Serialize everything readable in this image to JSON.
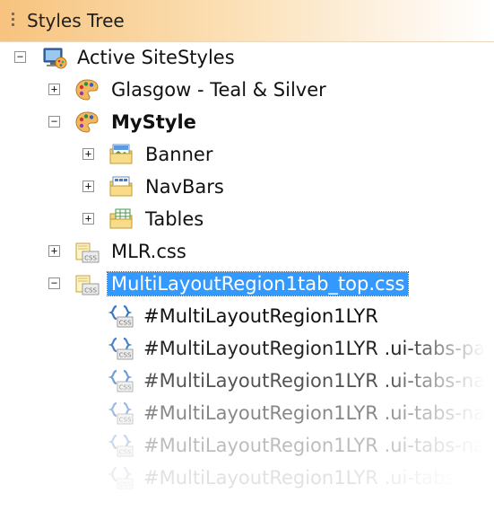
{
  "panel": {
    "title": "Styles Tree"
  },
  "tree": {
    "root": {
      "label": "Active SiteStyles",
      "expander": "−"
    },
    "styles": [
      {
        "label": "Glasgow - Teal & Silver",
        "expander": "+"
      },
      {
        "label": "MyStyle",
        "expander": "−"
      }
    ],
    "mystyle_children": [
      {
        "label": "Banner",
        "expander": "+"
      },
      {
        "label": "NavBars",
        "expander": "+"
      },
      {
        "label": "Tables",
        "expander": "+"
      }
    ],
    "css_files": [
      {
        "label": "MLR.css",
        "expander": "+"
      },
      {
        "label": "MultiLayoutRegion1tab_top.css",
        "expander": "−"
      }
    ],
    "rules": [
      {
        "label": "#MultiLayoutRegion1LYR"
      },
      {
        "label": "#MultiLayoutRegion1LYR .ui-tabs-pa"
      },
      {
        "label": "#MultiLayoutRegion1LYR .ui-tabs-na"
      },
      {
        "label": "#MultiLayoutRegion1LYR .ui-tabs-na"
      },
      {
        "label": "#MultiLayoutRegion1LYR .ui-tabs-na"
      },
      {
        "label": "#MultiLayoutRegion1LYR .ui-tabs-"
      }
    ]
  },
  "colors": {
    "selection": "#3399ff",
    "title_gradient_start": "#f7c37e"
  }
}
